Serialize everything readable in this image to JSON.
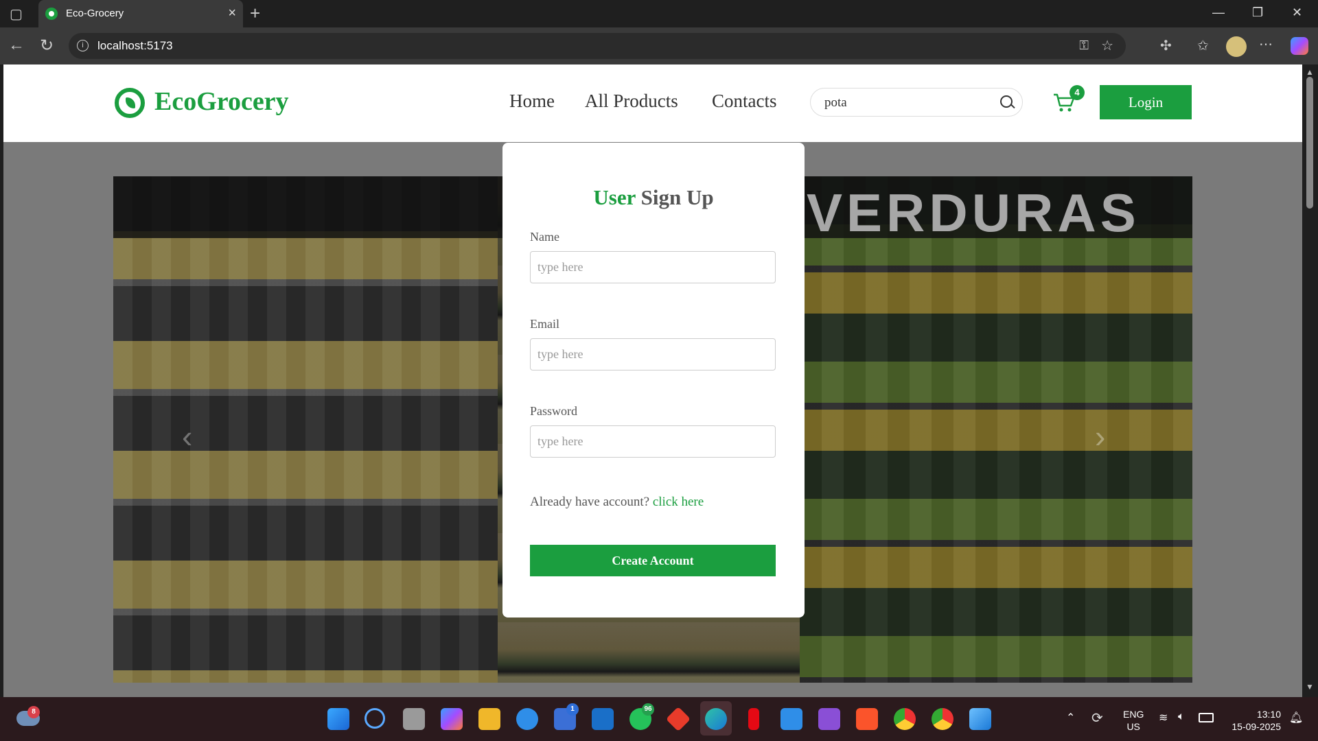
{
  "browser": {
    "tab_title": "Eco-Grocery",
    "tab_close": "×",
    "new_tab": "+",
    "url": "localhost:5173",
    "window_controls": {
      "minimize": "—",
      "restore": "❐",
      "close": "✕"
    }
  },
  "nav": {
    "logo": "EcoGrocery",
    "links": [
      "Home",
      "All Products",
      "Contacts"
    ],
    "search_value": "pota",
    "cart_count": "4",
    "login_label": "Login"
  },
  "hero": {
    "sign_text": "VERDURAS",
    "prev_arrow": "‹",
    "next_arrow": "›"
  },
  "signup": {
    "title_highlight": "User",
    "title_rest": " Sign Up",
    "fields": [
      {
        "label": "Name",
        "placeholder": "type here"
      },
      {
        "label": "Email",
        "placeholder": "type here"
      },
      {
        "label": "Password",
        "placeholder": "type here"
      }
    ],
    "already_text": "Already have account? ",
    "already_link": "click here",
    "submit_label": "Create Account"
  },
  "taskbar": {
    "weather_badge": "8",
    "store_badge": "1",
    "whatsapp_badge": "96",
    "language": "ENG",
    "region": "US",
    "time": "13:10",
    "date": "15-09-2025"
  },
  "colors": {
    "brand": "#1b9e3f"
  }
}
